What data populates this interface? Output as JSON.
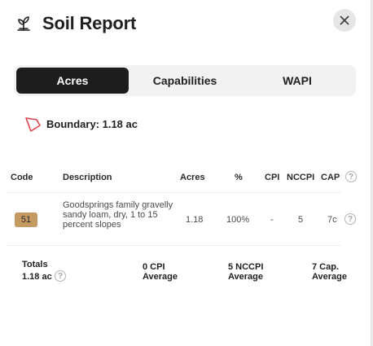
{
  "header": {
    "title": "Soil Report",
    "logo_icon": "sprout-icon",
    "close_icon": "close-icon"
  },
  "tabs": [
    {
      "label": "Acres",
      "active": true
    },
    {
      "label": "Capabilities",
      "active": false
    },
    {
      "label": "WAPI",
      "active": false
    }
  ],
  "boundary": {
    "icon": "polygon-boundary-icon",
    "label": "Boundary: 1.18 ac",
    "color": "#e0424d"
  },
  "table": {
    "columns": [
      "Code",
      "Description",
      "Acres",
      "%",
      "CPI",
      "NCCPI",
      "CAP"
    ],
    "help_icon": "?",
    "rows": [
      {
        "code": "51",
        "code_color": "#c49a62",
        "description": "Goodsprings family gravelly sandy loam, dry, 1 to 15 percent slopes",
        "acres": "1.18",
        "percent": "100%",
        "cpi": "-",
        "nccpi": "5",
        "cap": "7c"
      }
    ]
  },
  "totals": {
    "label": "Totals",
    "acres": "1.18 ac",
    "cpi_value": "0 CPI",
    "cpi_suffix": "Average",
    "nccpi_value": "5 NCCPI",
    "nccpi_suffix": "Average",
    "cap_value": "7 Cap.",
    "cap_suffix": "Average"
  },
  "colors": {
    "active_tab_bg": "#1d1d1d",
    "tab_track_bg": "#f2f2f2"
  }
}
